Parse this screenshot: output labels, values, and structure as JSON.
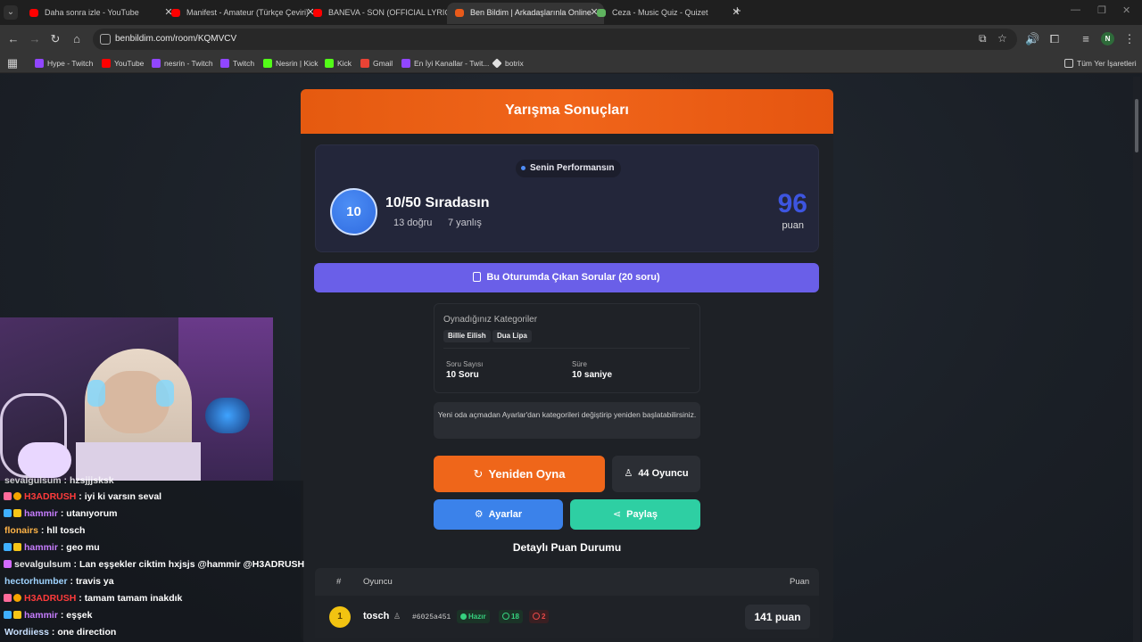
{
  "browser": {
    "tabs": [
      {
        "title": "Daha sonra izle - YouTube",
        "favicon_color": "#ff0000",
        "active": false
      },
      {
        "title": "Manifest - Amateur (Türkçe Çeviri)",
        "favicon_color": "#ff0000",
        "active": false
      },
      {
        "title": "BANEVA - SON (OFFICIAL LYRIC)",
        "favicon_color": "#ff0000",
        "active": false
      },
      {
        "title": "Ben Bildim | Arkadaşlarınla Online",
        "favicon_color": "#e85a1a",
        "active": true
      },
      {
        "title": "Ceza - Music Quiz - Quizet",
        "favicon_color": "#5fb35f",
        "active": false
      }
    ],
    "url": "benbildim.com/room/KQMVCV",
    "profile_initial": "N",
    "bookmarks": [
      {
        "label": "Hype - Twitch",
        "color": "#9146ff"
      },
      {
        "label": "YouTube",
        "color": "#ff0000"
      },
      {
        "label": "nesrin - Twitch",
        "color": "#9146ff"
      },
      {
        "label": "Twitch",
        "color": "#9146ff"
      },
      {
        "label": "Nesrin | Kick",
        "color": "#53fc18"
      },
      {
        "label": "Kick",
        "color": "#53fc18"
      },
      {
        "label": "Gmail",
        "color": "#ea4335"
      },
      {
        "label": "En İyi Kanallar - Twit...",
        "color": "#9146ff"
      },
      {
        "label": "botrix",
        "color": "#e0e0e0"
      }
    ],
    "all_bookmarks_label": "Tüm Yer İşaretleri"
  },
  "results": {
    "title": "Yarışma Sonuçları",
    "performance_label": "Senin Performansın",
    "rank_number": "10",
    "rank_text": "10/50 Sıradasın",
    "correct_text": "13 doğru",
    "wrong_text": "7 yanlış",
    "score": "96",
    "score_unit": "puan",
    "questions_button": "Bu Oturumda Çıkan Sorular (20 soru)",
    "categories_label": "Oynadığınız Kategoriler",
    "categories": [
      "Billie Eilish",
      "Dua Lipa"
    ],
    "question_count_label": "Soru Sayısı",
    "question_count_value": "10 Soru",
    "duration_label": "Süre",
    "duration_value": "10 saniye",
    "notice": "Yeni oda açmadan Ayarlar'dan kategorileri değiştirip yeniden başlatabilirsiniz.",
    "replay_button": "Yeniden Oyna",
    "players_button": "44 Oyuncu",
    "settings_button": "Ayarlar",
    "share_button": "Paylaş",
    "detail_title": "Detaylı Puan Durumu",
    "table": {
      "headers": {
        "rank": "#",
        "player": "Oyuncu",
        "score": "Puan"
      },
      "rows": [
        {
          "rank": "1",
          "name": "tosch",
          "id": "#6025a451",
          "status": "Hazır",
          "correct": "18",
          "wrong": "2",
          "score": "141 puan"
        }
      ]
    }
  },
  "chat": {
    "messages": [
      {
        "user": "sevalgulsum",
        "text": "hzsjjjsksk",
        "color": "#e8e8e8"
      },
      {
        "user": "H3ADRUSH",
        "text": "iyi ki varsın seval",
        "color": "#ff3b3b"
      },
      {
        "user": "hammir",
        "text": "utanıyorum",
        "color": "#c77dff"
      },
      {
        "user": "flonairs",
        "text": "hll tosch",
        "color": "#ffb347"
      },
      {
        "user": "hammir",
        "text": "geo mu",
        "color": "#c77dff"
      },
      {
        "user": "sevalgulsum",
        "text": "Lan eşşekler ciktim hxjsjs @hammir @H3ADRUSH",
        "color": "#e8e8e8"
      },
      {
        "user": "hectorhumber",
        "text": "travis ya",
        "color": "#9fd3ff"
      },
      {
        "user": "H3ADRUSH",
        "text": "tamam tamam inakdık",
        "color": "#ff3b3b"
      },
      {
        "user": "hammir",
        "text": "eşşek",
        "color": "#c77dff"
      },
      {
        "user": "Wordiiess",
        "text": "one direction",
        "color": "#c8e0ff"
      }
    ]
  },
  "colors": {
    "accent_orange": "#ef661a",
    "accent_purple": "#6a5fe8",
    "accent_blue": "#3b82ea",
    "accent_teal": "#2ecfa3",
    "score_blue": "#3d55e0"
  }
}
